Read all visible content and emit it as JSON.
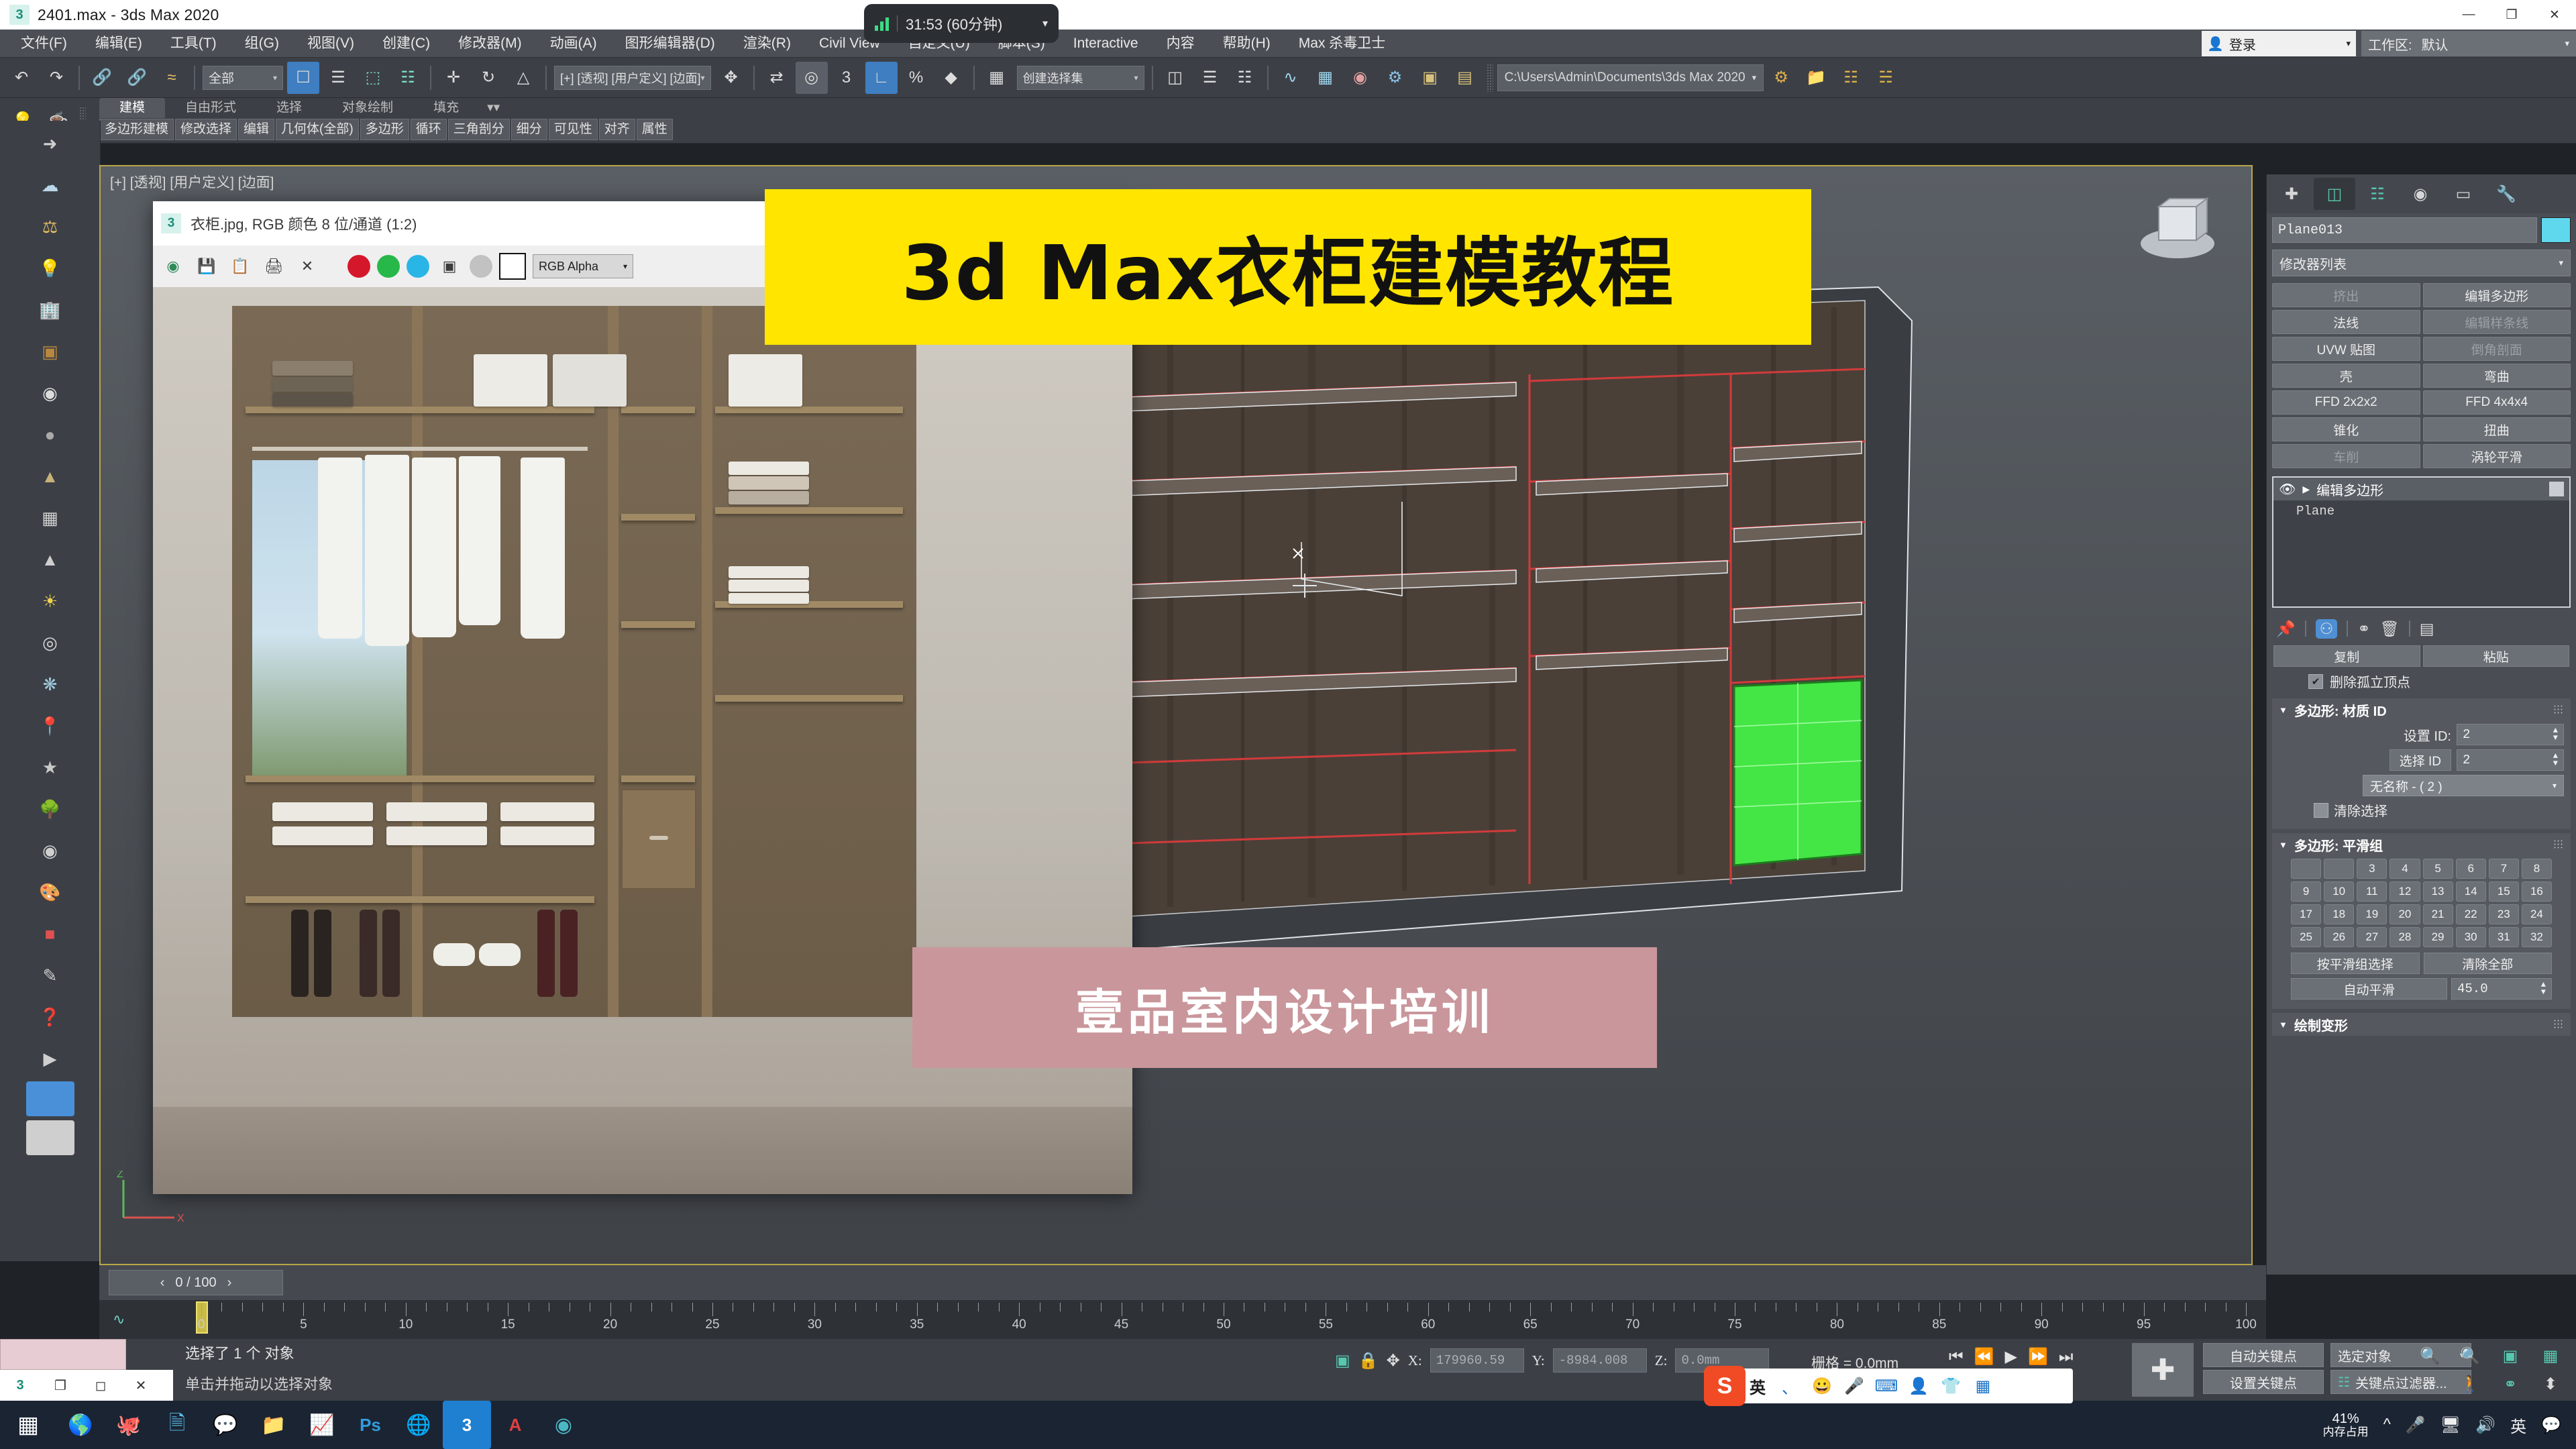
{
  "window": {
    "title": "2401.max - 3ds Max 2020",
    "app_icon": "3ds-max-icon",
    "minimize": "—",
    "maximize": "❐",
    "close": "✕"
  },
  "timer_overlay": {
    "signal_icon": "signal-bars-icon",
    "time": "31:53 (60分钟)",
    "chevron": "▾"
  },
  "menubar": {
    "items": [
      "文件(F)",
      "编辑(E)",
      "工具(T)",
      "组(G)",
      "视图(V)",
      "创建(C)",
      "修改器(M)",
      "动画(A)",
      "图形编辑器(D)",
      "渲染(R)",
      "Civil View",
      "自定义(U)",
      "脚本(S)",
      "Interactive",
      "内容",
      "帮助(H)",
      "Max 杀毒卫士"
    ]
  },
  "account": {
    "login_label": "登录",
    "login_icon": "user-icon",
    "workspace_label": "工作区:",
    "workspace_value": "默认"
  },
  "toolbar": {
    "undo": "undo-icon",
    "redo": "redo-icon",
    "select_filter": "全部",
    "project_path": "C:\\Users\\Admin\\Documents\\3ds Max 2020"
  },
  "ribbon": {
    "tabs": [
      "建模",
      "自由形式",
      "选择",
      "对象绘制",
      "填充"
    ],
    "active_tab": "建模",
    "panels": [
      "多边形建模",
      "修改选择",
      "编辑",
      "几何体(全部)",
      "多边形",
      "循环",
      "三角剖分",
      "细分",
      "可见性",
      "对齐",
      "属性"
    ]
  },
  "viewport": {
    "label": "[+] [透视] [用户定义] [边面]"
  },
  "image_window": {
    "app_icon": "3ds-max-icon",
    "title": "衣柜.jpg, RGB 颜色 8 位/通道 (1:2)",
    "tools": [
      "save-icon",
      "copy-icon",
      "print-icon",
      "close-icon"
    ],
    "channel_select": "RGB Alpha",
    "red_dot": "#d5172b",
    "green_dot": "#28b84a",
    "blue_dot": "#29b6e6"
  },
  "banners": {
    "top": "3d Max衣柜建模教程",
    "top_bg": "#ffe500",
    "bottom": "壹品室内设计培训",
    "bottom_bg": "#c9969b"
  },
  "command_panel": {
    "tabs": [
      "create-tab-icon",
      "modify-tab-icon",
      "hierarchy-tab-icon",
      "motion-tab-icon",
      "display-tab-icon",
      "utilities-tab-icon"
    ],
    "active_tab_index": 1,
    "object_name": "Plane013",
    "object_color": "#5fd8ee",
    "modifier_list_label": "修改器列表",
    "modifier_buttons": [
      "挤出",
      "编辑多边形",
      "法线",
      "编辑样条线",
      "UVW 贴图",
      "倒角剖面",
      "壳",
      "弯曲",
      "FFD 2x2x2",
      "FFD 4x4x4",
      "锥化",
      "扭曲",
      "车削",
      "涡轮平滑"
    ],
    "stack": {
      "eye_icon": "eye-icon",
      "expand_icon": "▶",
      "top_entry": "编辑多边形",
      "base_entry": "Plane"
    },
    "stack_tools": [
      "pin-icon",
      "show-end-result-icon",
      "make-unique-icon",
      "delete-icon",
      "configure-icon"
    ],
    "copy_label": "复制",
    "paste_label": "粘贴",
    "remove_isolated_vertices": "删除孤立顶点",
    "material_id": {
      "title": "多边形: 材质 ID",
      "set_id_label": "设置 ID:",
      "set_id_value": "2",
      "select_id_label": "选择 ID",
      "select_id_value": "2",
      "name_combo": "无名称 - ( 2 )",
      "clear_selection": "清除选择"
    },
    "smoothing": {
      "title": "多边形: 平滑组",
      "groups": [
        "",
        "",
        "3",
        "4",
        "5",
        "6",
        "7",
        "8",
        "9",
        "10",
        "11",
        "12",
        "13",
        "14",
        "15",
        "16",
        "17",
        "18",
        "19",
        "20",
        "21",
        "22",
        "23",
        "24",
        "25",
        "26",
        "27",
        "28",
        "29",
        "30",
        "31",
        "32"
      ],
      "select_by_sg": "按平滑组选择",
      "clear_all": "清除全部",
      "auto_smooth": "自动平滑",
      "auto_smooth_value": "45.0"
    },
    "paint_deform_title": "绘制变形"
  },
  "timeline": {
    "frame_display": "0 / 100",
    "prev_arrow": "‹",
    "next_arrow": "›",
    "tick_labels": [
      "0",
      "5",
      "10",
      "15",
      "20",
      "25",
      "30",
      "35",
      "40",
      "45",
      "50",
      "55",
      "60",
      "65",
      "70",
      "75",
      "80",
      "85",
      "90",
      "95",
      "100"
    ]
  },
  "statusbar": {
    "selection_text": "选择了 1 个 对象",
    "hint_text": "单击并拖动以选择对象",
    "coord_x_label": "X:",
    "coord_x_value": "179960.59",
    "coord_y_label": "Y:",
    "coord_y_value": "-8984.008",
    "coord_z_label": "Z:",
    "coord_z_value": "0.0mm",
    "grid_text": "栅格 = 0.0mm",
    "auto_key": "自动关键点",
    "set_key": "设置关键点",
    "selected_object": "选定对象",
    "key_filter": "关键点过滤器...",
    "lock_icon": "lock-icon",
    "absolute_icon": "absolute-mode-icon",
    "minimize_icon": "selection-lock-icon"
  },
  "taskbar": {
    "start_icon": "windows-start-icon",
    "apps": [
      "edge-icon",
      "qq-icon",
      "explorer-icon",
      "wechat-icon",
      "folder-icon",
      "chart-icon",
      "photoshop-icon",
      "browser-icon",
      "3dsmax-icon",
      "autocad-icon",
      "app-icon"
    ],
    "memory_percent": "41%",
    "memory_label": "内存占用",
    "tray": [
      "chevron-up-icon",
      "microphone-icon",
      "network-icon",
      "volume-icon",
      "ime-english-icon",
      "notifications-icon"
    ]
  },
  "ime": {
    "logo": "S",
    "lang": "英",
    "icons": [
      "smiley-icon",
      "microphone-icon",
      "keyboard-icon",
      "user-icon",
      "skin-icon",
      "apps-icon"
    ]
  }
}
